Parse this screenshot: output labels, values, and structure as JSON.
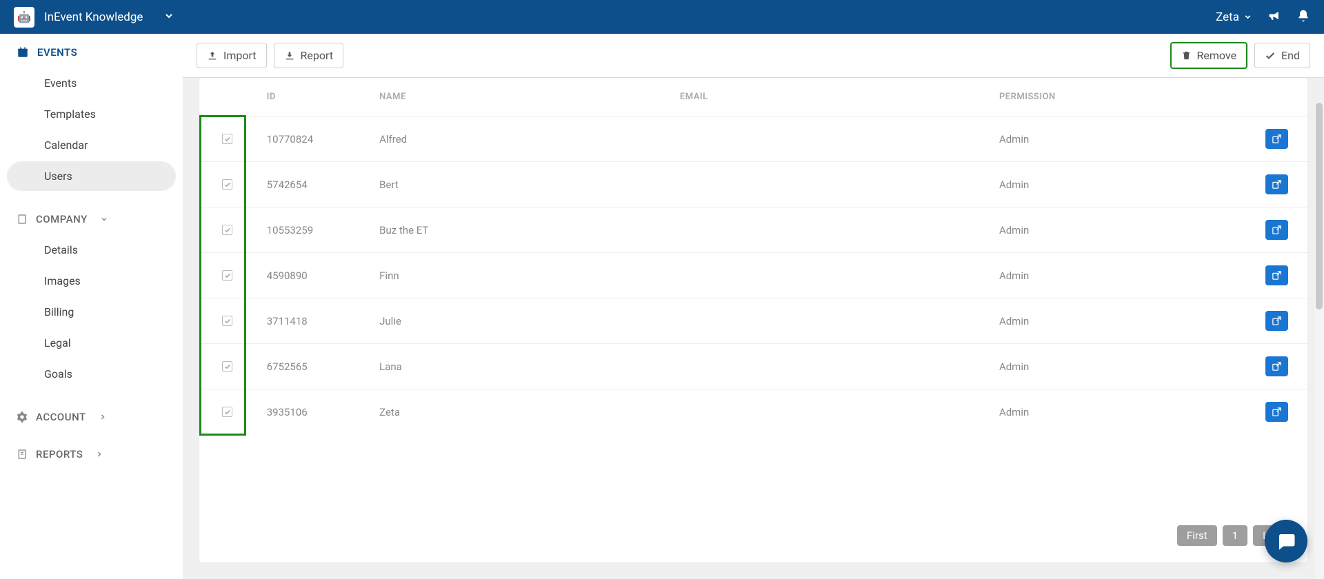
{
  "topbar": {
    "brand": "InEvent Knowledge",
    "user": "Zeta"
  },
  "sidebar": {
    "events_head": "EVENTS",
    "events_items": [
      "Events",
      "Templates",
      "Calendar",
      "Users"
    ],
    "events_active_index": 3,
    "company_head": "COMPANY",
    "company_items": [
      "Details",
      "Images",
      "Billing",
      "Legal",
      "Goals"
    ],
    "account_head": "ACCOUNT",
    "reports_head": "REPORTS"
  },
  "actions": {
    "import_label": "Import",
    "report_label": "Report",
    "remove_label": "Remove",
    "end_label": "End"
  },
  "table": {
    "headers": {
      "id": "ID",
      "name": "NAME",
      "email": "EMAIL",
      "permission": "PERMISSION"
    },
    "rows": [
      {
        "id": "10770824",
        "name": "Alfred",
        "email": "",
        "permission": "Admin",
        "checked": true
      },
      {
        "id": "5742654",
        "name": "Bert",
        "email": "",
        "permission": "Admin",
        "checked": true
      },
      {
        "id": "10553259",
        "name": "Buz the ET",
        "email": "",
        "permission": "Admin",
        "checked": true
      },
      {
        "id": "4590890",
        "name": "Finn",
        "email": "",
        "permission": "Admin",
        "checked": true
      },
      {
        "id": "3711418",
        "name": "Julie",
        "email": "",
        "permission": "Admin",
        "checked": true
      },
      {
        "id": "6752565",
        "name": "Lana",
        "email": "",
        "permission": "Admin",
        "checked": true
      },
      {
        "id": "3935106",
        "name": "Zeta",
        "email": "",
        "permission": "Admin",
        "checked": true
      }
    ]
  },
  "pagination": {
    "first": "First",
    "page": "1",
    "last": "Last"
  }
}
